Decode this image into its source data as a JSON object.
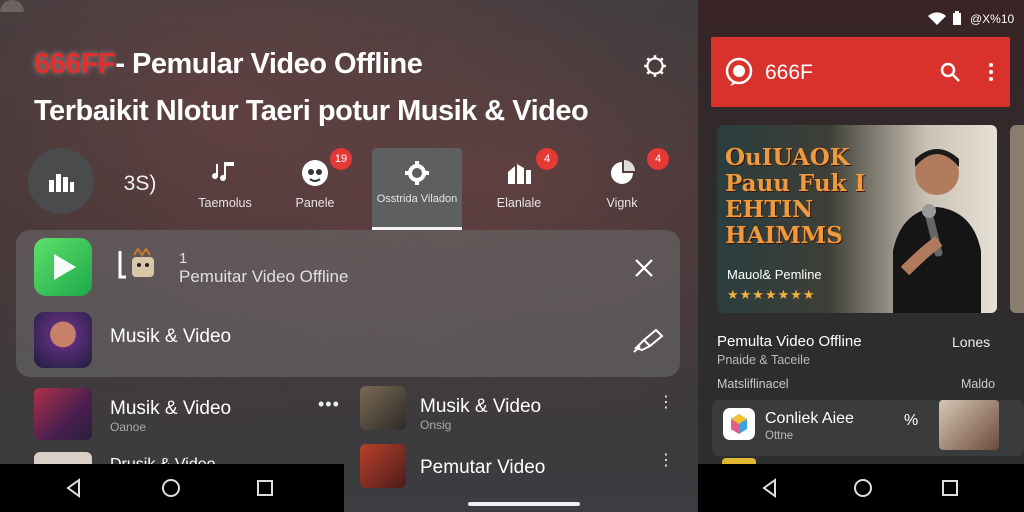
{
  "left": {
    "headline_brand": "666FF",
    "headline_rest": "- Pemular Video Offline",
    "headline_line2": "Terbaikit Nlotur Taeri potur Musik & Video",
    "tabs": [
      {
        "label": "",
        "icon": "bars-icon"
      },
      {
        "label": "3S)",
        "icon": ""
      },
      {
        "label": "Taemolus",
        "icon": "music-note-icon"
      },
      {
        "label": "Panele",
        "icon": "panda-icon",
        "badge": "19"
      },
      {
        "label": "Osstrida Viladon",
        "icon": "gear-icon"
      },
      {
        "label": "Elanlale",
        "icon": "chart-icon",
        "badge": "4"
      },
      {
        "label": "Vignk",
        "icon": "pie-icon",
        "badge": "4"
      }
    ],
    "notification": {
      "index": "1",
      "title": "Pemuitar Video Offline",
      "subtitle": "Musik & Video"
    },
    "list": [
      {
        "title": "Musik & Video",
        "sub": "Oanoe"
      },
      {
        "title": "Drusik & Video",
        "sub": ""
      },
      {
        "title": "Musik & Video",
        "sub": "Onsig"
      },
      {
        "title": "Pemutar Video",
        "sub": ""
      }
    ]
  },
  "right": {
    "status_text": "@X%10",
    "app_title": "666F",
    "hero": {
      "title": "OuIUAOK Pauu Fuk I EHTIN HAIMMS",
      "caption": "Mauol& Pemline",
      "stars": "★★★★★★★"
    },
    "section": {
      "title": "Pemulta Video Offline",
      "action": "Lones",
      "subtitle": "Pnaide & Taceile",
      "title2": "Matsliflinacel",
      "action2": "Maldo"
    },
    "card": {
      "title": "Conliek Aiee",
      "sub": "Ottne",
      "symbol": "%"
    }
  },
  "colors": {
    "brand_red": "#d9312c",
    "badge_red": "#e53935",
    "star_gold": "#f2b33d"
  }
}
